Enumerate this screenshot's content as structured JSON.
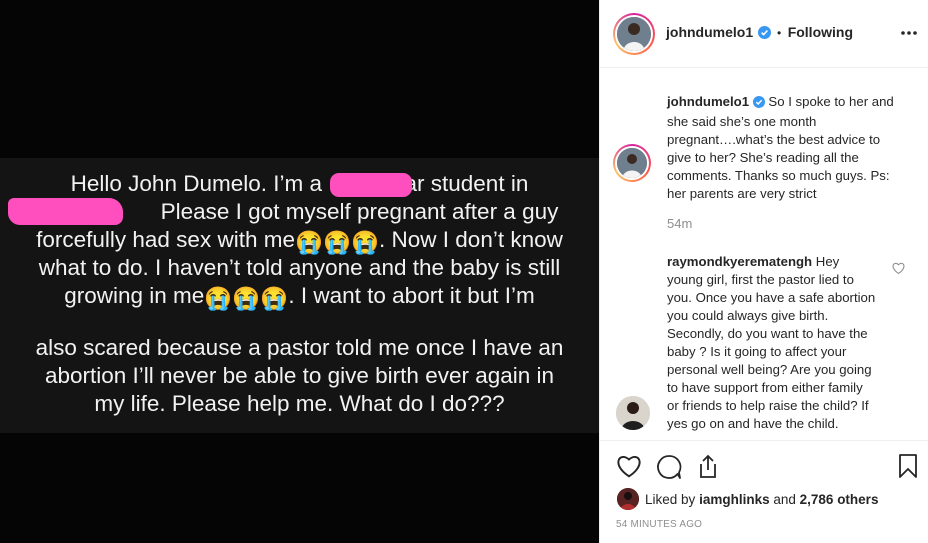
{
  "media": {
    "lines": [
      {
        "before": "Hello John Dumelo. I’m a",
        "after": "ear student in"
      },
      {
        "before": "",
        "after": "Please I got myself pregnant after a guy"
      },
      {
        "before": "forcefully had sex with me",
        "emoji_count": 3,
        "after": ". Now I don’t know"
      },
      {
        "before": "what to do. I haven’t told anyone and the baby is still"
      },
      {
        "before": "growing in me",
        "emoji_count": 3,
        "after": ". I want to abort it but I’m"
      },
      {
        "before": "also scared because a pastor told me once I have an"
      },
      {
        "before": "abortion I’ll never be able to give birth ever again in"
      },
      {
        "before": "my life. Please help me. What do I do???"
      }
    ],
    "emoji": "😭",
    "redaction_color": "#ff4fbf"
  },
  "header": {
    "username": "johndumelo1",
    "separator": "•",
    "follow_label": "Following",
    "more_icon": "more-horizontal-icon"
  },
  "caption": {
    "username": "johndumelo1",
    "text": "So I spoke to her and she said she’s one month pregnant….what’s the best advice to give to her? She’s reading all the comments. Thanks so much guys. Ps: her parents are very strict",
    "time": "54m"
  },
  "comments": [
    {
      "username": "raymondkyerematengh",
      "text": "Hey young girl, first the pastor lied to you. Once you have a safe abortion you could always give birth. Secondly, do you want to have the baby ? Is it going to affect your personal well being? Are you going to have support from either family or friends to help raise the child? If yes go on and have the child."
    }
  ],
  "likes": {
    "prefix": "Liked by",
    "user": "iamghlinks",
    "and": "and",
    "others": "2,786 others"
  },
  "timestamp": "54 MINUTES AGO",
  "colors": {
    "verified": "#3897f0",
    "text": "#262626",
    "muted": "#8e8e8e"
  }
}
